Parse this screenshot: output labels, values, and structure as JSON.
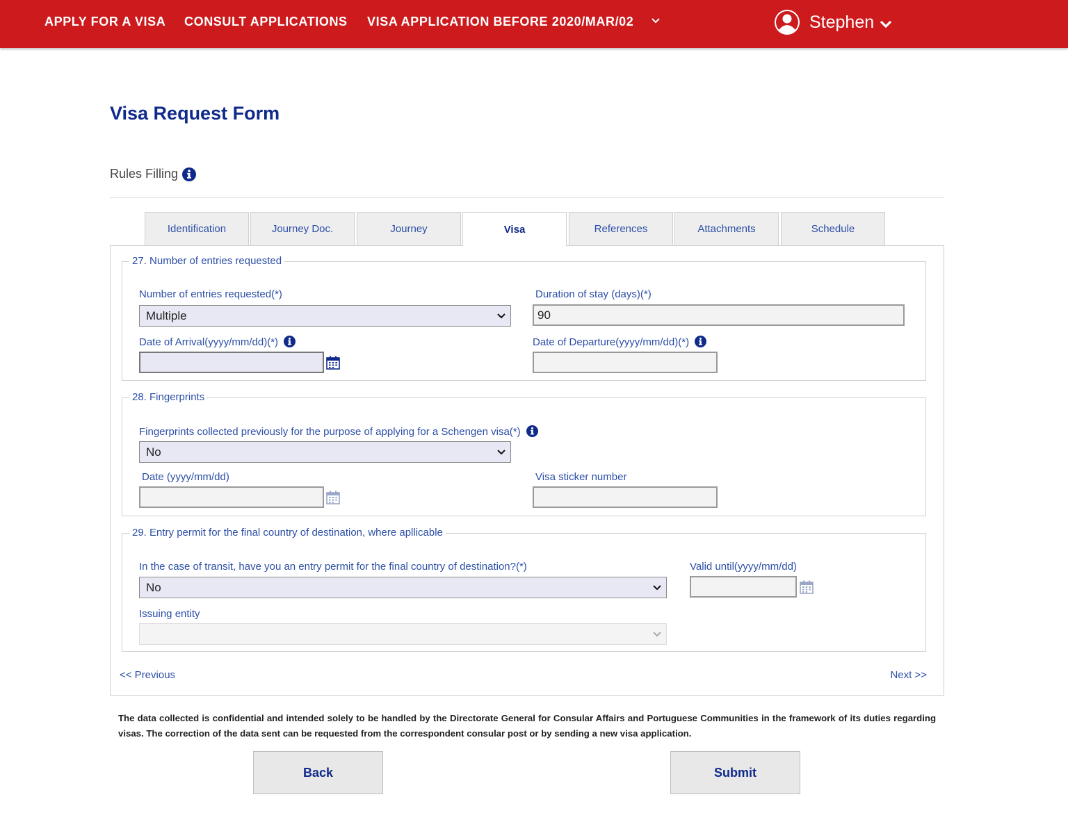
{
  "nav": {
    "items": [
      {
        "label": "APPLY FOR A VISA"
      },
      {
        "label": "CONSULT APPLICATIONS"
      },
      {
        "label": "VISA APPLICATION BEFORE 2020/MAR/02"
      }
    ],
    "user": {
      "name": "Stephen"
    }
  },
  "page": {
    "title": "Visa Request Form",
    "rules_label": "Rules Filling"
  },
  "tabs": [
    {
      "label": "Identification"
    },
    {
      "label": "Journey Doc."
    },
    {
      "label": "Journey"
    },
    {
      "label": "Visa",
      "active": true
    },
    {
      "label": "References"
    },
    {
      "label": "Attachments"
    },
    {
      "label": "Schedule"
    }
  ],
  "section27": {
    "legend": "27. Number of entries requested",
    "entries_label": "Number of entries requested(*)",
    "entries_value": "Multiple",
    "duration_label": "Duration of stay (days)(*)",
    "duration_value": "90",
    "arrival_label": "Date of Arrival(yyyy/mm/dd)(*)",
    "arrival_value": "",
    "departure_label": "Date of Departure(yyyy/mm/dd)(*)",
    "departure_value": ""
  },
  "section28": {
    "legend": "28. Fingerprints",
    "fp_label": "Fingerprints collected previously for the purpose of applying for a Schengen visa(*)",
    "fp_value": "No",
    "date_label": "Date (yyyy/mm/dd)",
    "date_value": "",
    "sticker_label": "Visa sticker number",
    "sticker_value": ""
  },
  "section29": {
    "legend": "29. Entry permit for the final country of destination, where apllicable",
    "transit_label": "In the case of transit, have you an entry permit for the final country of destination?(*)",
    "transit_value": "No",
    "valid_label": "Valid until(yyyy/mm/dd)",
    "valid_value": "",
    "issuing_label": "Issuing entity",
    "issuing_value": ""
  },
  "pager": {
    "previous": "<< Previous",
    "next": "Next >>"
  },
  "footer": {
    "notice": "The data collected is confidential and intended solely to be handled by the Directorate General for Consular Affairs and Portuguese Communities in the framework of its duties regarding visas. The correction of the data sent can be requested from the correspondent consular post or by sending a new visa application.",
    "back": "Back",
    "submit": "Submit"
  },
  "colors": {
    "brand_red": "#cc1a1d",
    "title_blue": "#0f2a8a",
    "label_blue": "#2b4ea6",
    "select_bg": "#e8e8f4"
  },
  "icons": [
    "user-avatar-icon",
    "chevron-down-icon",
    "info-icon",
    "calendar-icon"
  ]
}
